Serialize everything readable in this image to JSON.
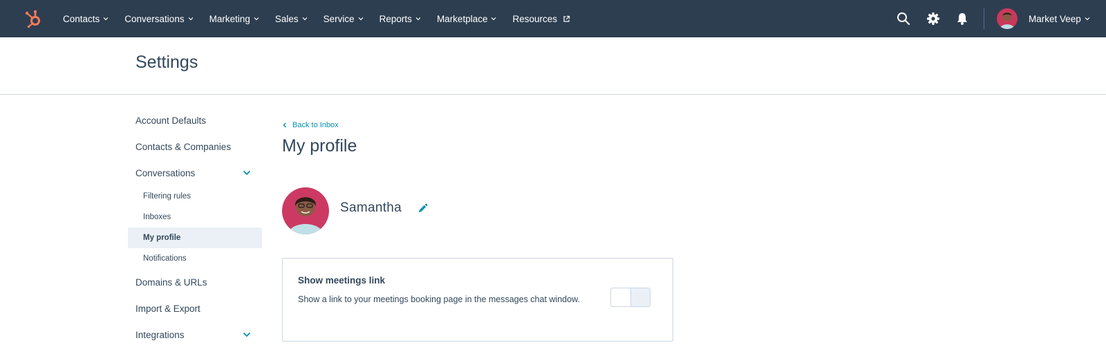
{
  "topnav": {
    "logo_icon": "hubspot-sprocket-icon",
    "items": [
      {
        "label": "Contacts"
      },
      {
        "label": "Conversations"
      },
      {
        "label": "Marketing"
      },
      {
        "label": "Sales"
      },
      {
        "label": "Service"
      },
      {
        "label": "Reports"
      },
      {
        "label": "Marketplace"
      },
      {
        "label": "Resources"
      }
    ],
    "account_name": "Market Veep",
    "icons": [
      "search-icon",
      "gear-icon",
      "bell-icon"
    ],
    "bg_color": "#2d3e50",
    "logo_color": "#ff7a59"
  },
  "header": {
    "title": "Settings"
  },
  "sidebar": {
    "items": [
      {
        "label": "Account Defaults"
      },
      {
        "label": "Contacts & Companies"
      },
      {
        "label": "Conversations"
      },
      {
        "label": "Domains & URLs"
      },
      {
        "label": "Import & Export"
      },
      {
        "label": "Integrations"
      }
    ],
    "conversations_sub": [
      {
        "label": "Filtering rules"
      },
      {
        "label": "Inboxes"
      },
      {
        "label": "My profile",
        "active": true
      },
      {
        "label": "Notifications"
      }
    ]
  },
  "main": {
    "back_link": "Back to Inbox",
    "title": "My profile",
    "profile_name": "Samantha",
    "card": {
      "title": "Show meetings link",
      "description": "Show a link to your meetings booking page in the messages chat window.",
      "toggle_on": false
    },
    "accent_color": "#0091ae"
  }
}
